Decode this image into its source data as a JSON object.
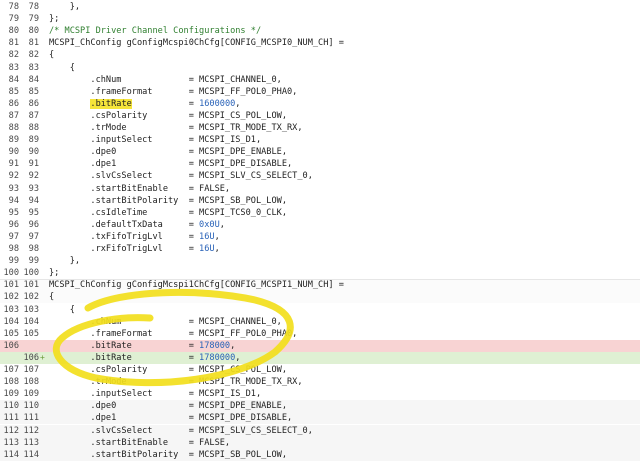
{
  "lines": [
    {
      "a": "78",
      "b": "78",
      "m": "",
      "t": "    },",
      "st": "sec1"
    },
    {
      "a": "79",
      "b": "79",
      "m": "",
      "t": "};",
      "st": "sec1"
    },
    {
      "a": "80",
      "b": "80",
      "m": "",
      "t": "/* MCSPI Driver Channel Configurations */",
      "st": "sec1",
      "kind": "comment"
    },
    {
      "a": "81",
      "b": "81",
      "m": "",
      "t": "MCSPI_ChConfig gConfigMcspi0ChCfg[CONFIG_MCSPI0_NUM_CH] =",
      "st": "sec1"
    },
    {
      "a": "82",
      "b": "82",
      "m": "",
      "t": "{",
      "st": "sec1"
    },
    {
      "a": "83",
      "b": "83",
      "m": "",
      "t": "    {",
      "st": "sec1"
    },
    {
      "a": "84",
      "b": "84",
      "m": "",
      "t": "        .chNum             = MCSPI_CHANNEL_0,",
      "st": "sec1"
    },
    {
      "a": "85",
      "b": "85",
      "m": "",
      "t": "        .frameFormat       = MCSPI_FF_POL0_PHA0,",
      "st": "sec1"
    },
    {
      "a": "86",
      "b": "86",
      "m": "",
      "t": "        .bitRate           = 1600000,",
      "st": "sec1",
      "hi": ".bitRate",
      "num": "1600000"
    },
    {
      "a": "87",
      "b": "87",
      "m": "",
      "t": "        .csPolarity        = MCSPI_CS_POL_LOW,",
      "st": "sec1"
    },
    {
      "a": "88",
      "b": "88",
      "m": "",
      "t": "        .trMode            = MCSPI_TR_MODE_TX_RX,",
      "st": "sec1"
    },
    {
      "a": "89",
      "b": "89",
      "m": "",
      "t": "        .inputSelect       = MCSPI_IS_D1,",
      "st": "sec1"
    },
    {
      "a": "90",
      "b": "90",
      "m": "",
      "t": "        .dpe0              = MCSPI_DPE_ENABLE,",
      "st": "sec1"
    },
    {
      "a": "91",
      "b": "91",
      "m": "",
      "t": "        .dpe1              = MCSPI_DPE_DISABLE,",
      "st": "sec1"
    },
    {
      "a": "92",
      "b": "92",
      "m": "",
      "t": "        .slvCsSelect       = MCSPI_SLV_CS_SELECT_0,",
      "st": "sec1"
    },
    {
      "a": "93",
      "b": "93",
      "m": "",
      "t": "        .startBitEnable    = FALSE,",
      "st": "sec1"
    },
    {
      "a": "94",
      "b": "94",
      "m": "",
      "t": "        .startBitPolarity  = MCSPI_SB_POL_LOW,",
      "st": "sec1"
    },
    {
      "a": "95",
      "b": "95",
      "m": "",
      "t": "        .csIdleTime        = MCSPI_TCS0_0_CLK,",
      "st": "sec1"
    },
    {
      "a": "96",
      "b": "96",
      "m": "",
      "t": "        .defaultTxData     = 0x0U,",
      "st": "sec1",
      "num": "0x0U"
    },
    {
      "a": "97",
      "b": "97",
      "m": "",
      "t": "        .txFifoTrigLvl     = 16U,",
      "st": "sec1",
      "num": "16U"
    },
    {
      "a": "98",
      "b": "98",
      "m": "",
      "t": "        .rxFifoTrigLvl     = 16U,",
      "st": "sec1",
      "num": "16U"
    },
    {
      "a": "99",
      "b": "99",
      "m": "",
      "t": "    },",
      "st": "sec1"
    },
    {
      "a": "100",
      "b": "100",
      "m": "",
      "t": "};",
      "st": "sec1"
    },
    {
      "a": "101",
      "b": "101",
      "m": "",
      "t": "MCSPI_ChConfig gConfigMcspi1ChCfg[CONFIG_MCSPI1_NUM_CH] =",
      "st": "hunk"
    },
    {
      "a": "102",
      "b": "102",
      "m": "",
      "t": "{",
      "st": "hunk"
    },
    {
      "a": "103",
      "b": "103",
      "m": "",
      "t": "    {",
      "st": "white"
    },
    {
      "a": "104",
      "b": "104",
      "m": "",
      "t": "        .chNum             = MCSPI_CHANNEL_0,",
      "st": "white"
    },
    {
      "a": "105",
      "b": "105",
      "m": "",
      "t": "        .frameFormat       = MCSPI_FF_POL0_PHA0,",
      "st": "white"
    },
    {
      "a": "106",
      "b": "",
      "m": "",
      "t": "        .bitRate           = 178000,",
      "st": "deleted",
      "num": "178000"
    },
    {
      "a": "",
      "b": "106",
      "m": "+",
      "t": "        .bitRate           = 1780000,",
      "st": "added",
      "num": "1780000"
    },
    {
      "a": "107",
      "b": "107",
      "m": "",
      "t": "        .csPolarity        = MCSPI_CS_POL_LOW,",
      "st": "white"
    },
    {
      "a": "108",
      "b": "108",
      "m": "",
      "t": "        .trMode            = MCSPI_TR_MODE_TX_RX,",
      "st": "white"
    },
    {
      "a": "109",
      "b": "109",
      "m": "",
      "t": "        .inputSelect       = MCSPI_IS_D1,",
      "st": "white"
    },
    {
      "a": "110",
      "b": "110",
      "m": "",
      "t": "        .dpe0              = MCSPI_DPE_ENABLE,",
      "st": "sec2"
    },
    {
      "a": "111",
      "b": "111",
      "m": "",
      "t": "        .dpe1              = MCSPI_DPE_DISABLE,",
      "st": "sec2"
    },
    {
      "a": "112",
      "b": "112",
      "m": "",
      "t": "        .slvCsSelect       = MCSPI_SLV_CS_SELECT_0,",
      "st": "sec2"
    },
    {
      "a": "113",
      "b": "113",
      "m": "",
      "t": "        .startBitEnable    = FALSE,",
      "st": "sec2"
    },
    {
      "a": "114",
      "b": "114",
      "m": "",
      "t": "        .startBitPolarity  = MCSPI_SB_POL_LOW,",
      "st": "sec2"
    }
  ],
  "colors": {
    "comment": "#2f7f2f",
    "number": "#2a63b8",
    "highlight": "#f6e53a",
    "deleted": "#f8d3d3",
    "added": "#dff0d3",
    "annotation": "#f2de1c"
  }
}
